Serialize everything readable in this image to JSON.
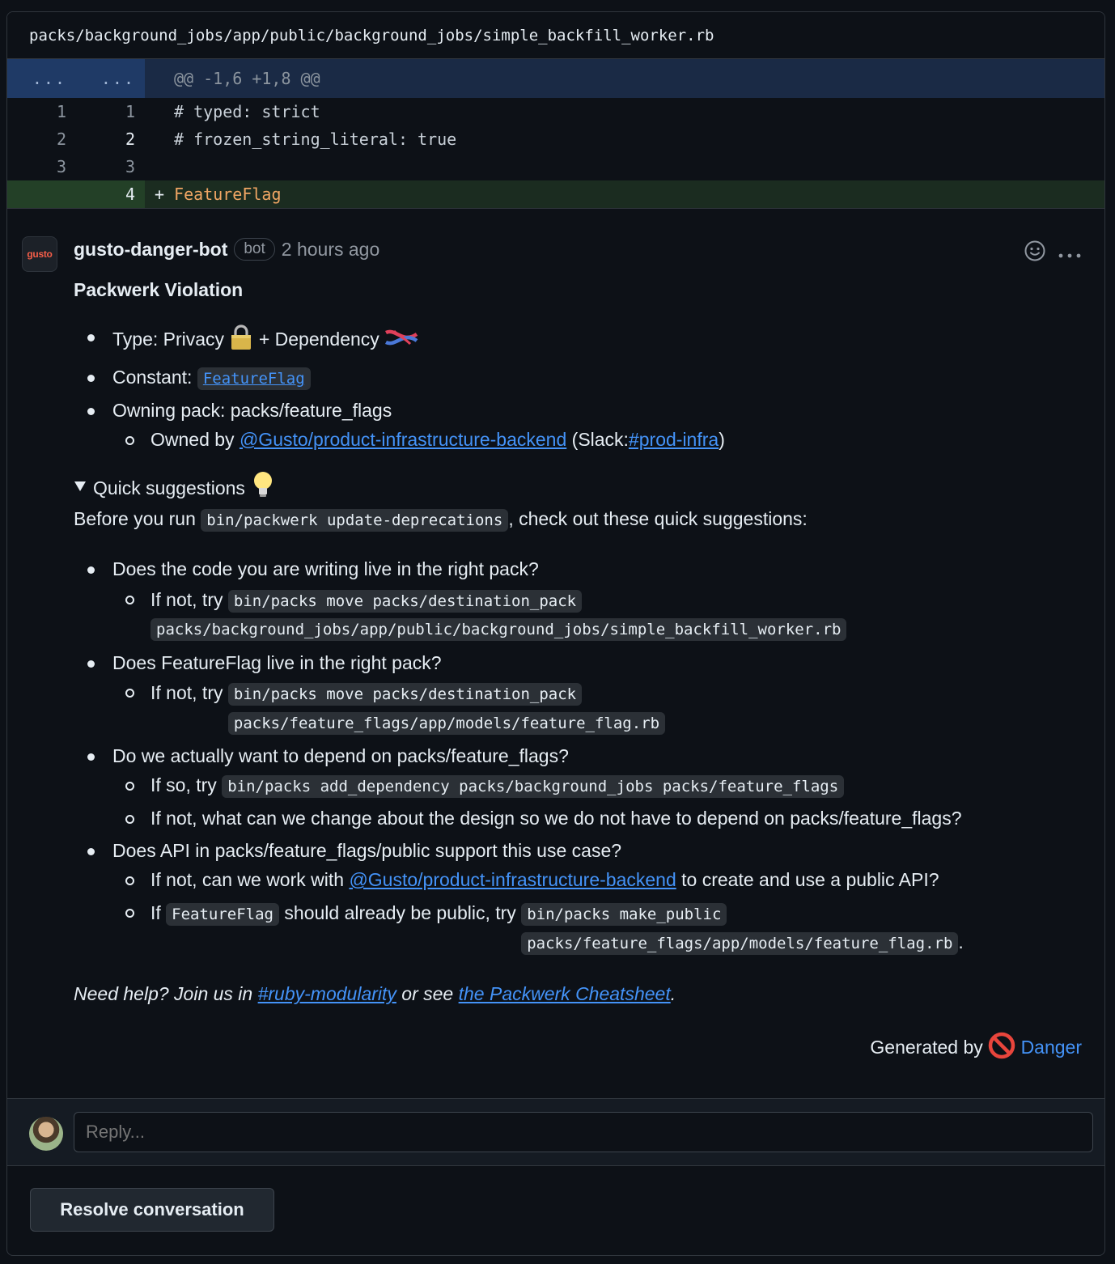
{
  "file": {
    "path": "packs/background_jobs/app/public/background_jobs/simple_backfill_worker.rb"
  },
  "diff": {
    "hunk": {
      "old_marker": "...",
      "new_marker": "...",
      "header": "@@ -1,6 +1,8 @@"
    },
    "lines": [
      {
        "old": "1",
        "new": "1",
        "code": "# typed: strict"
      },
      {
        "old": "2",
        "new": "2",
        "code": "# frozen_string_literal: true"
      },
      {
        "old": "3",
        "new": "3",
        "code": ""
      }
    ],
    "added": {
      "new": "4",
      "plus": "+",
      "code": "FeatureFlag"
    }
  },
  "comment": {
    "avatar_text": "gusto",
    "author": "gusto-danger-bot",
    "badge": "bot",
    "time": "2 hours ago",
    "title": "Packwerk Violation",
    "type_label": "Type: Privacy",
    "dependency_label": "+ Dependency",
    "constant_label": "Constant:",
    "constant_value": "FeatureFlag",
    "owning_pack": "Owning pack: packs/feature_flags",
    "owned_by_prefix": "Owned by",
    "owned_by_link": "@Gusto/product-infrastructure-backend",
    "slack_prefix": "(Slack:",
    "slack_link": "#prod-infra",
    "slack_suffix": ")",
    "quick_title": "Quick suggestions",
    "before_prefix": "Before you run",
    "before_code": "bin/packwerk update-deprecations",
    "before_suffix": ", check out these quick suggestions:",
    "suggestions": {
      "q1": "Does the code you are writing live in the right pack?",
      "q1_prefix": "If not, try",
      "q1_code": "bin/packs move packs/destination_pack packs/background_jobs/app/public/background_jobs/simple_backfill_worker.rb",
      "q2": "Does FeatureFlag live in the right pack?",
      "q2_prefix": "If not, try",
      "q2_code": "bin/packs move packs/destination_pack packs/feature_flags/app/models/feature_flag.rb",
      "q3": "Do we actually want to depend on packs/feature_flags?",
      "q3a_prefix": "If so, try",
      "q3a_code": "bin/packs add_dependency packs/background_jobs packs/feature_flags",
      "q3b": "If not, what can we change about the design so we do not have to depend on packs/feature_flags?",
      "q4": "Does API in packs/feature_flags/public support this use case?",
      "q4a_prefix": "If not, can we work with",
      "q4a_link": "@Gusto/product-infrastructure-backend",
      "q4a_suffix": "to create and use a public API?",
      "q4b_prefix": "If",
      "q4b_code1": "FeatureFlag",
      "q4b_middle": "should already be public, try",
      "q4b_code2": "bin/packs make_public packs/feature_flags/app/models/feature_flag.rb",
      "q4b_suffix": "."
    },
    "help_prefix": "Need help? Join us in",
    "help_link1": "#ruby-modularity",
    "help_middle": "or see",
    "help_link2": "the Packwerk Cheatsheet",
    "help_suffix": ".",
    "generated_prefix": "Generated by",
    "generated_link": "Danger"
  },
  "reply": {
    "placeholder": "Reply..."
  },
  "resolve_label": "Resolve conversation",
  "icons": [
    "smiley-icon",
    "kebab-menu-icon",
    "lock-icon",
    "knot-icon",
    "lightbulb-icon",
    "no-entry-icon",
    "triangle-down-icon"
  ]
}
